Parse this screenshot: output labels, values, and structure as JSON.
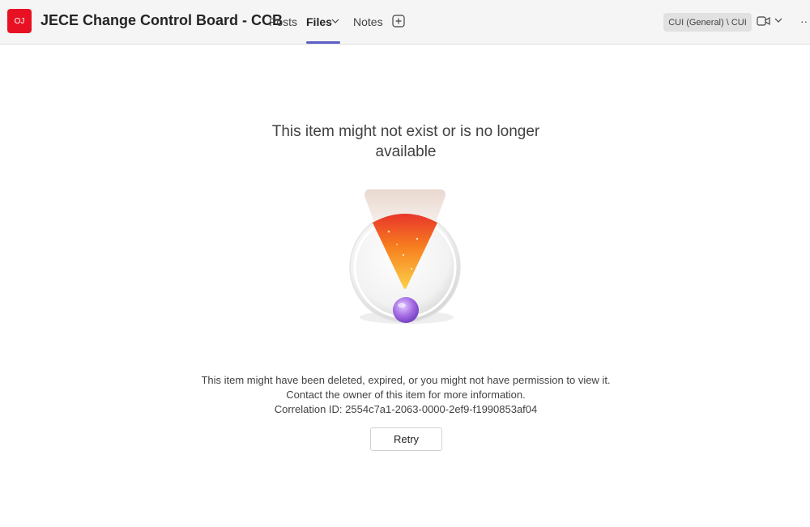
{
  "header": {
    "team_initials": "OJ",
    "team_title": "JECE Change Control Board - CCB",
    "tabs": [
      {
        "label": "Posts"
      },
      {
        "label": "Files"
      },
      {
        "label": "Notes"
      }
    ],
    "active_tab": "Files",
    "channel_label": "CUI (General) \\ CUI",
    "more_label": "··"
  },
  "main": {
    "error_title": "This item might not exist or is no longer available",
    "message_line1": "This item might have been deleted, expired, or you might not have permission to view it.",
    "message_line2": "Contact the owner of this item for more information.",
    "correlation_line": "Correlation ID: 2554c7a1-2063-0000-2ef9-f1990853af04",
    "retry_label": "Retry"
  },
  "colors": {
    "brand_accent": "#5b5fc7",
    "avatar_red": "#e81123"
  },
  "icons": [
    "chevron-down-icon",
    "add-tab-icon",
    "video-camera-icon",
    "more-options-icon",
    "exclamation-illustration"
  ]
}
